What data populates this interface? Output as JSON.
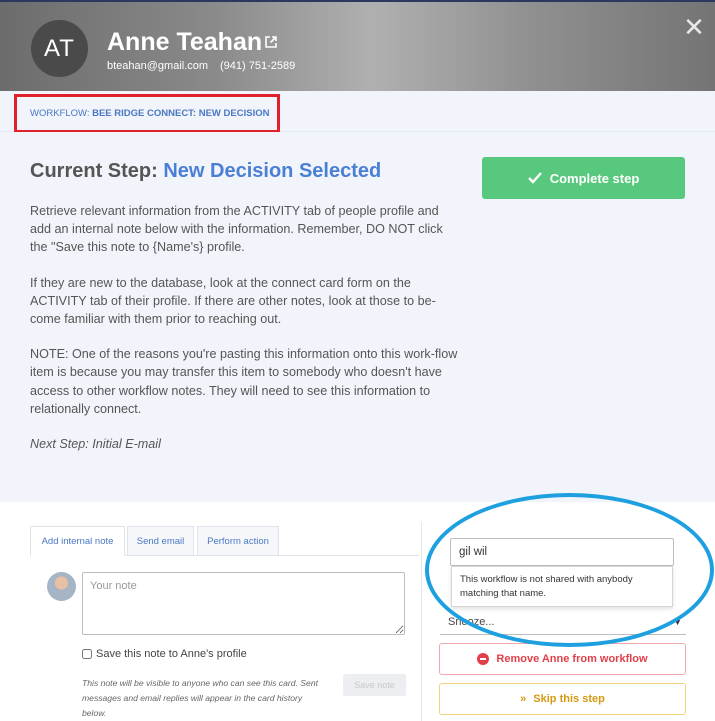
{
  "contact": {
    "initials": "AT",
    "name": "Anne Teahan",
    "email": "bteahan@gmail.com",
    "phone": "(941) 751-2589"
  },
  "icons": {
    "external_link": "external-link-icon",
    "close": "close-icon",
    "check": "check-icon",
    "remove": "minus-circle-icon",
    "skip": "double-chevron-right-icon",
    "caret": "caret-down-icon"
  },
  "workflow": {
    "prefix": "WORKFLOW: ",
    "name": "BEE RIDGE CONNECT: NEW DECISION"
  },
  "step": {
    "title_prefix": "Current Step: ",
    "title_name": "New Decision Selected",
    "paragraphs": [
      "Retrieve relevant information from the ACTIVITY tab of people profile and add an internal note below with the information. Remember, DO NOT click the \"Save this note to {Name's} profile.",
      "If they are new to the database, look at the connect card form on the ACTIVITY tab of their profile. If there are other notes, look at those to be-come familiar with them prior to reaching out.",
      "NOTE: One of the reasons you're pasting this information onto this work-flow item is because you may transfer this item to somebody who doesn't have access to other workflow notes. They will need to see this information to relationally connect."
    ],
    "next_step": "Next Step: Initial E-mail",
    "complete_label": "Complete step"
  },
  "tabs": [
    {
      "label": "Add internal note",
      "active": true
    },
    {
      "label": "Send email",
      "active": false
    },
    {
      "label": "Perform action",
      "active": false
    }
  ],
  "note": {
    "placeholder": "Your note",
    "save_to_profile_label": "Save this note to Anne's profile",
    "visibility_text": "This note will be visible to anyone who can see this card. Sent messages and email replies will appear in the card history below.",
    "save_button": "Save note"
  },
  "assign": {
    "input_value": "gil wil",
    "message": "This workflow is not shared with anybody matching that name."
  },
  "snooze": {
    "label": "Snooze..."
  },
  "actions": {
    "remove_label": "Remove Anne from workflow",
    "skip_label": "Skip this step"
  },
  "colors": {
    "accent_blue": "#4a7fd6",
    "complete_green": "#58c87e",
    "remove_red": "#e0404a",
    "skip_amber": "#d69a12",
    "annotation_red_box": "#e0202a",
    "annotation_blue_ellipse": "#1ea0e0"
  }
}
